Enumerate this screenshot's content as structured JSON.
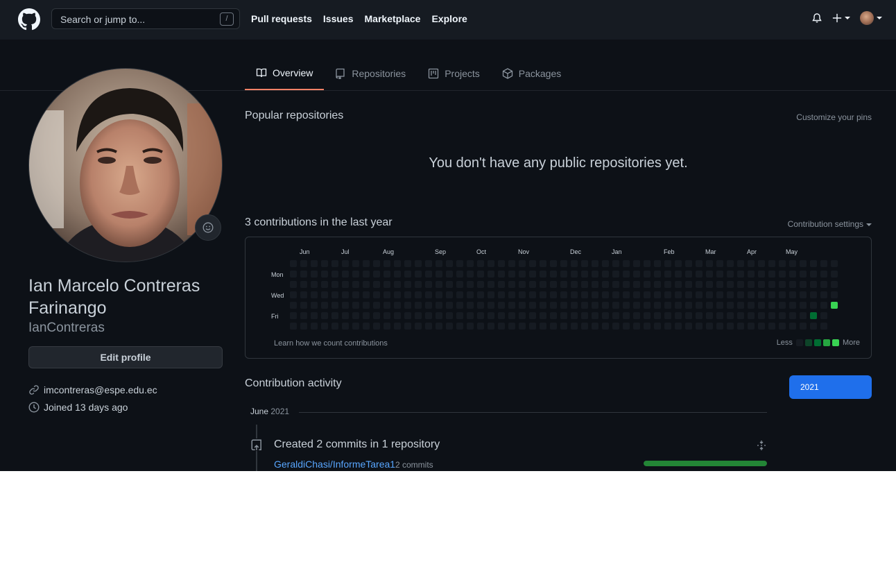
{
  "header": {
    "search_placeholder": "Search or jump to...",
    "search_shortcut": "/",
    "nav": [
      "Pull requests",
      "Issues",
      "Marketplace",
      "Explore"
    ],
    "icons": [
      "github-logo",
      "bell-icon",
      "plus-icon",
      "avatar"
    ]
  },
  "tabs": [
    {
      "label": "Overview",
      "icon": "book-icon",
      "active": true
    },
    {
      "label": "Repositories",
      "icon": "repo-icon",
      "active": false
    },
    {
      "label": "Projects",
      "icon": "project-icon",
      "active": false
    },
    {
      "label": "Packages",
      "icon": "package-icon",
      "active": false
    }
  ],
  "profile": {
    "full_name": "Ian Marcelo Contreras Farinango",
    "login": "IanContreras",
    "edit_label": "Edit profile",
    "email": "imcontreras@espe.edu.ec",
    "joined": "Joined 13 days ago"
  },
  "popular": {
    "title": "Popular repositories",
    "customize": "Customize your pins",
    "empty": "You don't have any public repositories yet."
  },
  "contributions": {
    "title": "3 contributions in the last year",
    "settings": "Contribution settings",
    "months": [
      "Jun",
      "Jul",
      "Aug",
      "Sep",
      "Oct",
      "Nov",
      "Dec",
      "Jan",
      "Feb",
      "Mar",
      "Apr",
      "May"
    ],
    "days": [
      "Mon",
      "Wed",
      "Fri"
    ],
    "learn": "Learn how we count contributions",
    "less": "Less",
    "more": "More",
    "active_cells": [
      {
        "week": 50,
        "day": 5,
        "level": 2
      },
      {
        "week": 52,
        "day": 4,
        "level": 4
      }
    ],
    "colors": [
      "#161b22",
      "#0e4429",
      "#006d32",
      "#26a641",
      "#39d353"
    ]
  },
  "activity": {
    "title": "Contribution activity",
    "year_button": "2021",
    "month": "June",
    "year": "2021",
    "event_title": "Created 2 commits in 1 repository",
    "repo": "GeraldiChasi/InformeTarea1",
    "commit_count": "2 commits",
    "progress": 1.0
  }
}
